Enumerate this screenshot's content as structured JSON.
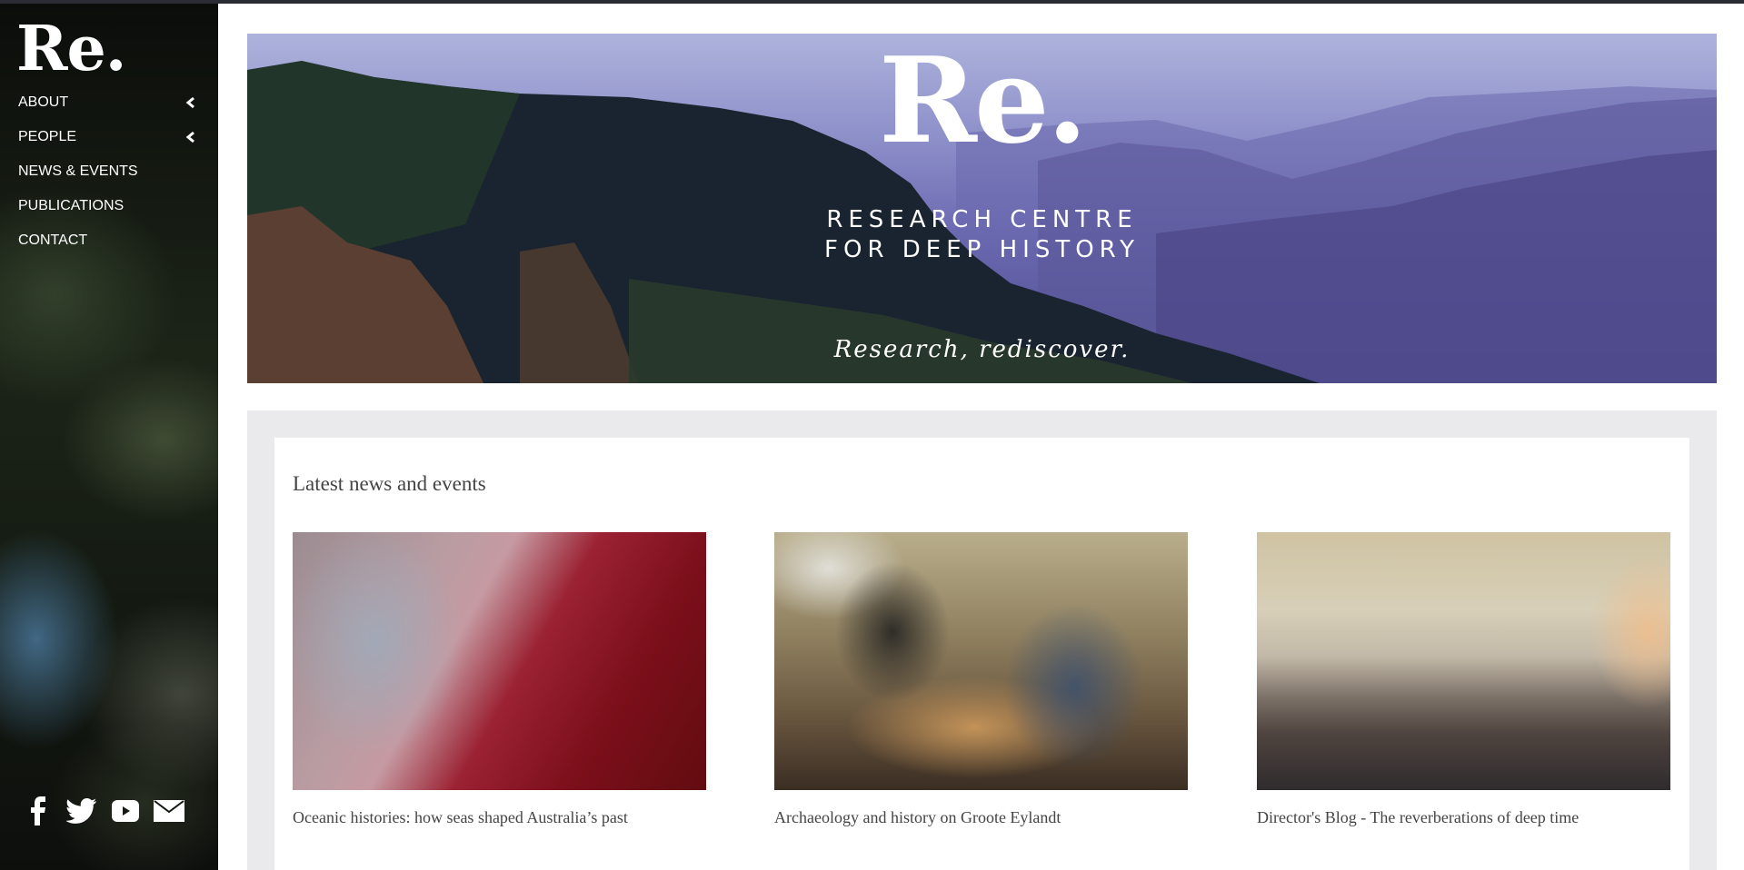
{
  "sidebar": {
    "logo": "Re.",
    "nav": [
      {
        "label": "ABOUT",
        "has_submenu": true
      },
      {
        "label": "PEOPLE",
        "has_submenu": true
      },
      {
        "label": "NEWS & EVENTS",
        "has_submenu": false
      },
      {
        "label": "PUBLICATIONS",
        "has_submenu": false
      },
      {
        "label": "CONTACT",
        "has_submenu": false
      }
    ],
    "social_icons": [
      "facebook-icon",
      "twitter-icon",
      "youtube-icon",
      "email-icon"
    ]
  },
  "hero": {
    "logo": "Re.",
    "title_line1": "RESEARCH CENTRE",
    "title_line2": "FOR DEEP HISTORY",
    "tagline": "Research, rediscover."
  },
  "news": {
    "heading": "Latest news and events",
    "items": [
      {
        "caption": "Oceanic histories: how seas shaped Australia’s past"
      },
      {
        "caption": "Archaeology and history on Groote Eylandt"
      },
      {
        "caption": "Director's Blog - The reverberations of deep time"
      }
    ]
  },
  "colors": {
    "sidebar_bg": "#141a12",
    "text_dark": "#444444",
    "section_bg": "#eaeaec",
    "hero_sky": "#8d8fc9"
  }
}
